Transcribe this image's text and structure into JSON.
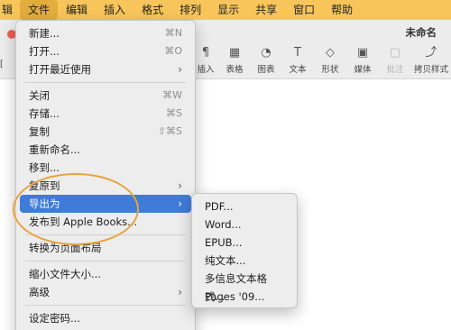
{
  "menubar": {
    "items": [
      "辑",
      "文件",
      "编辑",
      "插入",
      "格式",
      "排列",
      "显示",
      "共享",
      "窗口",
      "帮助"
    ]
  },
  "window": {
    "title": "未命名",
    "left_stub": "[",
    "toolbar": [
      {
        "label": "插入",
        "icon": "paragraph-icon",
        "glyph": "¶"
      },
      {
        "label": "表格",
        "icon": "table-icon",
        "glyph": "▦"
      },
      {
        "label": "图表",
        "icon": "chart-icon",
        "glyph": "◔"
      },
      {
        "label": "文本",
        "icon": "text-box-icon",
        "glyph": "T"
      },
      {
        "label": "形状",
        "icon": "shape-icon",
        "glyph": "◇"
      },
      {
        "label": "媒体",
        "icon": "media-icon",
        "glyph": "▣"
      },
      {
        "label": "批注",
        "icon": "comment-icon",
        "glyph": "▢"
      },
      {
        "label": "拷贝样式",
        "icon": "copy-style-icon",
        "glyph": "⤴"
      }
    ]
  },
  "file_menu": {
    "items": [
      {
        "label": "新建...",
        "shortcut": "⌘N"
      },
      {
        "label": "打开...",
        "shortcut": "⌘O"
      },
      {
        "label": "打开最近使用",
        "shortcut": "",
        "submenu": true
      },
      {
        "label": "关闭",
        "shortcut": "⌘W"
      },
      {
        "label": "存储...",
        "shortcut": "⌘S"
      },
      {
        "label": "复制",
        "shortcut": "⇧⌘S"
      },
      {
        "label": "重新命名...",
        "shortcut": ""
      },
      {
        "label": "移到...",
        "shortcut": ""
      },
      {
        "label": "复原到",
        "shortcut": "",
        "submenu": true
      },
      {
        "label": "导出为",
        "shortcut": "",
        "submenu": true,
        "highlighted": true
      },
      {
        "label": "发布到 Apple Books...",
        "shortcut": ""
      },
      {
        "label": "转换为页面布局",
        "shortcut": ""
      },
      {
        "label": "缩小文件大小...",
        "shortcut": ""
      },
      {
        "label": "高级",
        "shortcut": "",
        "submenu": true
      },
      {
        "label": "设定密码...",
        "shortcut": ""
      }
    ]
  },
  "export_submenu": {
    "items": [
      "PDF...",
      "Word...",
      "EPUB...",
      "纯文本...",
      "多信息文本格式...",
      "Pages '09..."
    ]
  },
  "colors": {
    "menubar": "#f7c55a",
    "highlight": "#3f7bd9",
    "annotation": "#e8a23b"
  }
}
